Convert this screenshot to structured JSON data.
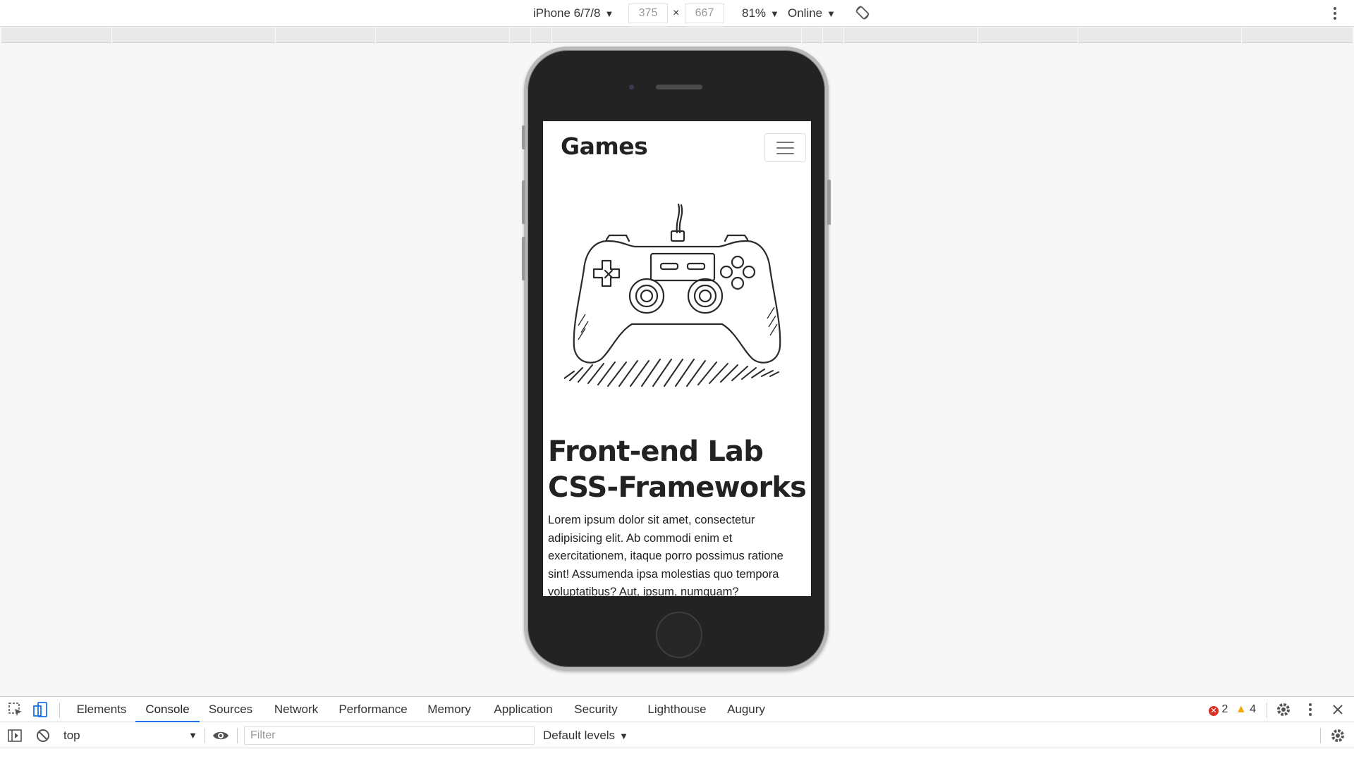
{
  "device_toolbar": {
    "device": "iPhone 6/7/8",
    "width": "375",
    "height": "667",
    "times": "×",
    "zoom": "81%",
    "network": "Online",
    "rotate_icon": "rotate-icon",
    "more_icon": "kebab-menu-icon"
  },
  "site": {
    "brand": "Games",
    "toggler_icon": "hamburger-icon",
    "illustration_icon": "gamepad-sketch-icon",
    "title_line1": "Front-end Lab",
    "title_line2": "CSS-Frameworks",
    "paragraph": "Lorem ipsum dolor sit amet, consectetur adipisicing elit. Ab commodi enim et exercitationem, itaque porro possimus ratione sint! Assumenda ipsa molestias quo tempora voluptatibus? Aut, ipsum, numquam?"
  },
  "devtools": {
    "tabs": [
      {
        "label": "Elements"
      },
      {
        "label": "Console"
      },
      {
        "label": "Sources"
      },
      {
        "label": "Network"
      },
      {
        "label": "Performance"
      },
      {
        "label": "Memory"
      },
      {
        "label": "Application"
      },
      {
        "label": "Security"
      },
      {
        "label": "Lighthouse"
      },
      {
        "label": "Augury"
      }
    ],
    "active_tab": "Console",
    "errors": "2",
    "warnings": "4",
    "context": "top",
    "filter_placeholder": "Filter",
    "levels": "Default levels"
  },
  "colors": {
    "accent": "#1a73e8",
    "error": "#d93025",
    "warning": "#f2a600",
    "phone_body": "#232323"
  }
}
